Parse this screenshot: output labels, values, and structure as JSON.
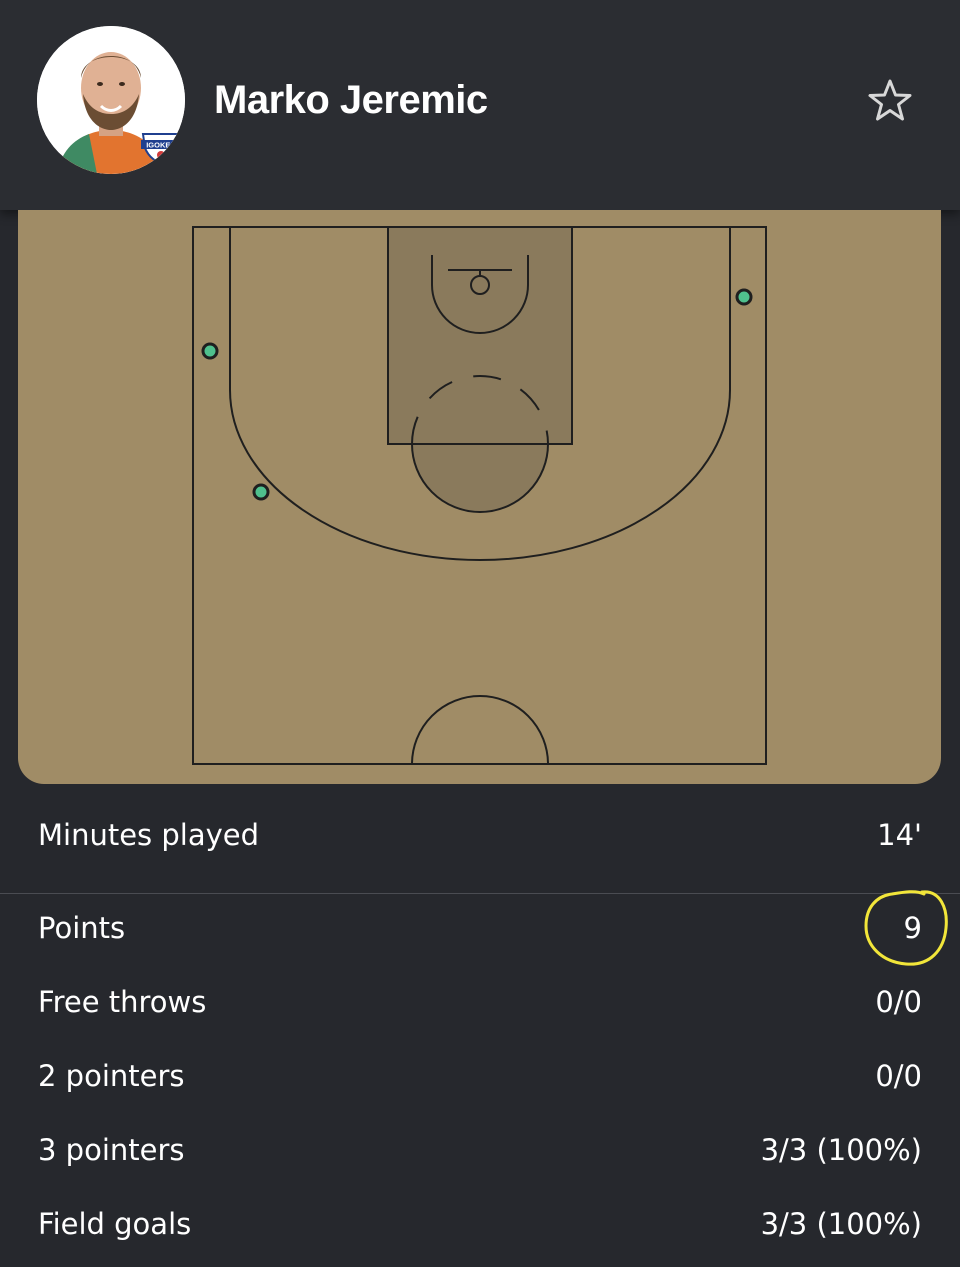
{
  "player": {
    "name": "Marko Jeremic",
    "team_badge": "IGOKEA"
  },
  "header": {
    "favorite_icon": "star-outline-icon"
  },
  "shot_map": {
    "shots": [
      {
        "result": "made",
        "type": "3pt"
      },
      {
        "result": "made",
        "type": "3pt"
      },
      {
        "result": "made",
        "type": "3pt"
      }
    ],
    "colors": {
      "court": "#a08c66",
      "paint": "#8a7a5c",
      "lines": "#1f1f1f",
      "made_shot": "#4fc08d"
    }
  },
  "stats": {
    "minutes": {
      "label": "Minutes played",
      "value": "14'"
    },
    "points": {
      "label": "Points",
      "value": "9"
    },
    "free_throws": {
      "label": "Free throws",
      "value": "0/0"
    },
    "two_pointers": {
      "label": "2 pointers",
      "value": "0/0"
    },
    "three_pointers": {
      "label": "3 pointers",
      "value": "3/3 (100%)"
    },
    "field_goals": {
      "label": "Field goals",
      "value": "3/3 (100%)"
    }
  },
  "annotation": {
    "color": "#f2e63a"
  }
}
